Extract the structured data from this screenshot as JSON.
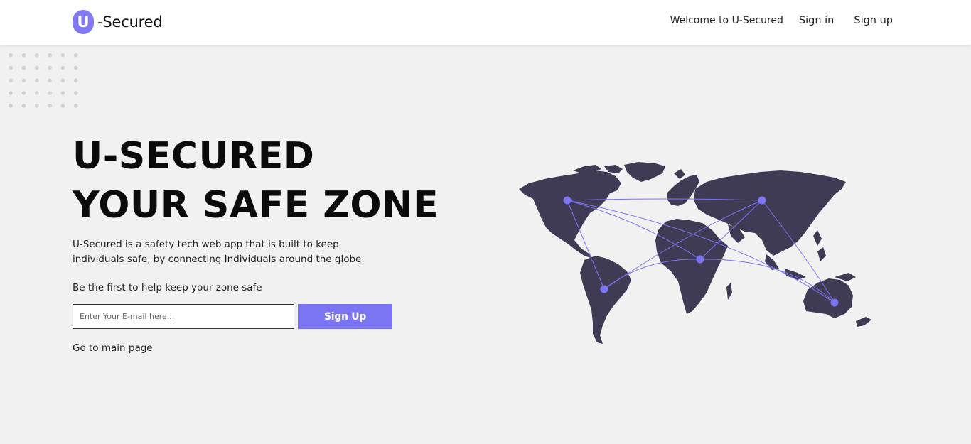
{
  "brand": {
    "badge": "U",
    "name": "-Secured",
    "accent_color": "#7b75f3"
  },
  "nav": {
    "welcome": "Welcome to U-Secured",
    "signin": "Sign in",
    "signup": "Sign up"
  },
  "hero": {
    "title_line1": "U-SECURED",
    "title_line2": "YOUR SAFE ZONE",
    "description": "U-Secured is a safety tech web app that is built to keep individuals safe, by connecting Individuals around the globe.",
    "cta_text": "Be the first to help keep your zone safe",
    "email_placeholder": "Enter Your E-mail here...",
    "email_value": "",
    "signup_button": "Sign Up",
    "main_page_link": "Go to main page"
  },
  "illustration": {
    "icon": "world-map-network-icon",
    "land_color": "#403b55",
    "connection_color": "#7b75f3"
  }
}
